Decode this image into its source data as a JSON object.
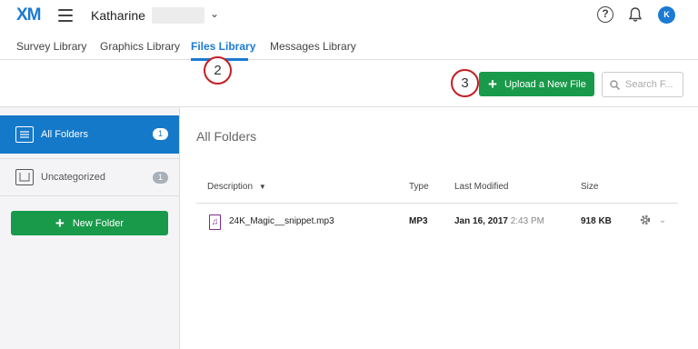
{
  "header": {
    "logo": "XM",
    "user_name": "Katharine",
    "avatar_initial": "K",
    "help_symbol": "?"
  },
  "tabs": [
    {
      "label": "Survey Library"
    },
    {
      "label": "Graphics Library"
    },
    {
      "label": "Files Library"
    },
    {
      "label": "Messages Library"
    }
  ],
  "annotations": {
    "step_tab": "2",
    "step_upload": "3"
  },
  "actions": {
    "upload_label": "Upload a New File",
    "search_placeholder": "Search F..."
  },
  "sidebar": {
    "folders": [
      {
        "label": "All Folders",
        "count": "1"
      },
      {
        "label": "Uncategorized",
        "count": "1"
      }
    ],
    "new_folder_label": "New Folder"
  },
  "main": {
    "title": "All Folders",
    "columns": {
      "description": "Description",
      "type": "Type",
      "last_modified": "Last Modified",
      "size": "Size"
    },
    "files": [
      {
        "name": "24K_Magic__snippet.mp3",
        "type": "MP3",
        "date": "Jan 16, 2017",
        "time": "2:43 PM",
        "size": "918 KB"
      }
    ]
  },
  "colors": {
    "accent": "#1b7ad3",
    "primary_button": "#199a4a",
    "annotation": "#c41e24",
    "audio_icon": "#7a2a8a"
  }
}
